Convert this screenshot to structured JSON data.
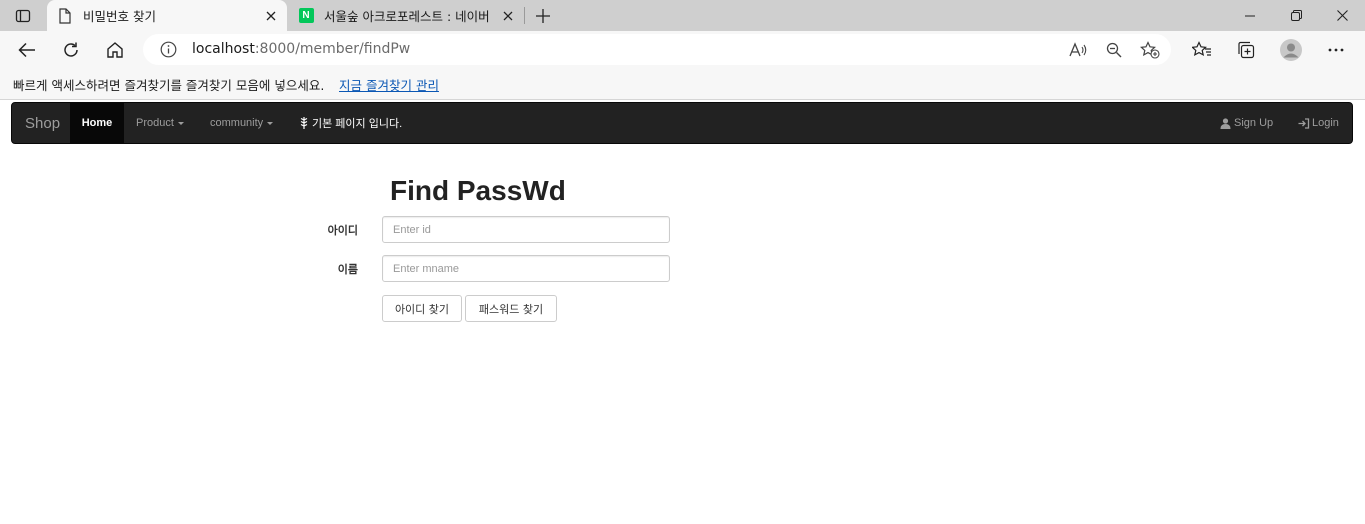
{
  "browser": {
    "tabs": [
      {
        "title": "비밀번호 찾기",
        "active": true,
        "icon": "document-icon"
      },
      {
        "title": "서울숲 아크로포레스트 : 네이버",
        "active": false,
        "icon": "naver-icon",
        "icon_letter": "N",
        "icon_color": "#03c75a"
      }
    ],
    "address": {
      "host": "localhost",
      "path": ":8000/member/findPw"
    },
    "favorites_bar": {
      "message": "빠르게 액세스하려면 즐겨찾기를 즐겨찾기 모음에 넣으세요.",
      "manage_link": "지금 즐겨찾기 관리"
    }
  },
  "navbar": {
    "brand": "Shop",
    "items": [
      {
        "label": "Home",
        "active": true
      },
      {
        "label": "Product",
        "dropdown": true
      },
      {
        "label": "community",
        "dropdown": true
      },
      {
        "label": "기본 페이지 입니다.",
        "icon": "grain-icon"
      }
    ],
    "right": [
      {
        "label": "Sign Up",
        "icon": "user-icon"
      },
      {
        "label": "Login",
        "icon": "login-icon"
      }
    ]
  },
  "form": {
    "title": "Find PassWd",
    "id_label": "아이디",
    "id_placeholder": "Enter id",
    "name_label": "이름",
    "name_placeholder": "Enter mname",
    "find_id_button": "아이디 찾기",
    "find_pw_button": "패스워드 찾기"
  },
  "colors": {
    "navbar_bg": "#222222",
    "navbar_active": "#080808",
    "link": "#0b57b4"
  }
}
